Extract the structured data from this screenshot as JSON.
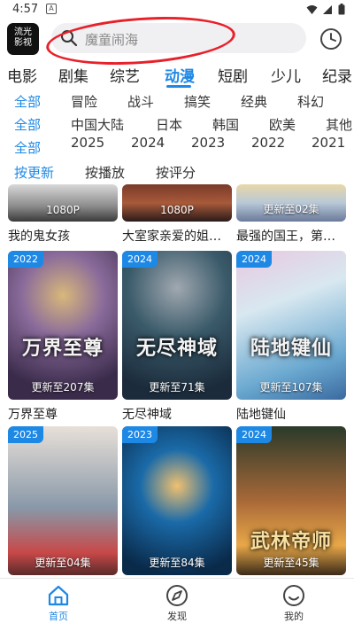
{
  "status": {
    "time": "4:57",
    "notif": "A"
  },
  "header": {
    "app_logo": "流光影视",
    "app_logo_line1": "流光",
    "app_logo_line2": "影视",
    "search_placeholder": "魔童闹海"
  },
  "categories": [
    "电影",
    "剧集",
    "综艺",
    "动漫",
    "短剧",
    "少儿",
    "纪录"
  ],
  "active_category": "动漫",
  "filters": {
    "genre": [
      "全部",
      "冒险",
      "战斗",
      "搞笑",
      "经典",
      "科幻"
    ],
    "region": [
      "全部",
      "中国大陆",
      "日本",
      "韩国",
      "欧美",
      "其他"
    ],
    "year": [
      "全部",
      "2025",
      "2024",
      "2023",
      "2022",
      "2021"
    ],
    "sort": [
      "按更新",
      "按播放",
      "按评分"
    ]
  },
  "top_row": [
    {
      "title": "我的鬼女孩",
      "caption": "1080P"
    },
    {
      "title": "大室家亲爱的姐…",
      "caption": "1080P"
    },
    {
      "title": "最强的国王，第…",
      "caption": "更新至02集"
    }
  ],
  "rows": [
    [
      {
        "year": "2022",
        "caption": "更新至207集",
        "title": "万界至尊",
        "art": "万界至尊",
        "colors": [
          "#3a2b4a",
          "#8a6b9b",
          "#d8b87a"
        ]
      },
      {
        "year": "2024",
        "caption": "更新至71集",
        "title": "无尽神域",
        "art": "无尽神域",
        "colors": [
          "#1b2b3b",
          "#3a5a6a",
          "#a0a8b0"
        ]
      },
      {
        "year": "2024",
        "caption": "更新至107集",
        "title": "陆地键仙",
        "art": "陆地键仙",
        "colors": [
          "#d8e8f0",
          "#6aa8d0",
          "#e8c8e0"
        ]
      }
    ],
    [
      {
        "year": "2025",
        "caption": "更新至04集",
        "title": "",
        "art": "",
        "colors": [
          "#e8e0d8",
          "#8898a8",
          "#c84848"
        ]
      },
      {
        "year": "2023",
        "caption": "更新至84集",
        "title": "",
        "art": "",
        "colors": [
          "#0a2a4a",
          "#1a6aa8",
          "#f0c070"
        ]
      },
      {
        "year": "2024",
        "caption": "更新至45集",
        "title": "",
        "art": "武林帝师",
        "colors": [
          "#2a3a2a",
          "#a86838",
          "#e8a848"
        ]
      }
    ]
  ],
  "bottom_nav": [
    {
      "label": "首页",
      "icon": "home-icon"
    },
    {
      "label": "发现",
      "icon": "discover-icon"
    },
    {
      "label": "我的",
      "icon": "profile-icon"
    }
  ],
  "colors": {
    "accent": "#1e88e5",
    "annotation": "#e8202a"
  }
}
